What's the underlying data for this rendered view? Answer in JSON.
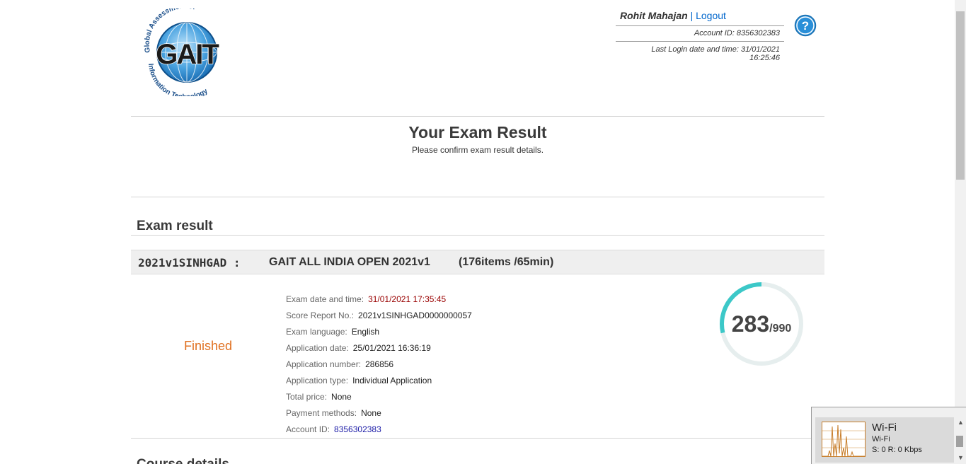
{
  "logo": {
    "arc_text": "Global Assessment of",
    "main_text": "GAIT",
    "bottom_text": "Information Technology"
  },
  "user": {
    "name": "Rohit Mahajan",
    "separator": "|",
    "logout_label": "Logout",
    "account_line": "Account ID: 8356302383",
    "last_login": "Last Login date and time: 31/01/2021 16:25:46"
  },
  "help": {
    "icon": "help-icon",
    "glyph": "?"
  },
  "page": {
    "title": "Your Exam Result",
    "subtitle": "Please confirm exam result details."
  },
  "section": {
    "title": "Exam result"
  },
  "exam": {
    "code": "2021v1SINHGAD :",
    "name": "GAIT ALL INDIA OPEN 2021v1",
    "meta": "(176items /65min)",
    "status": "Finished",
    "details": [
      {
        "label": "Exam date and time:",
        "value": "31/01/2021 17:35:45"
      },
      {
        "label": "Score Report No.:",
        "value": "2021v1SINHGAD0000000057"
      },
      {
        "label": "Exam language:",
        "value": "English"
      },
      {
        "label": "Application date:",
        "value": "25/01/2021 16:36:19"
      },
      {
        "label": "Application number:",
        "value": "286856"
      },
      {
        "label": "Application type:",
        "value": "Individual Application"
      },
      {
        "label": "Total price:",
        "value": "None"
      },
      {
        "label": "Payment methods:",
        "value": "None"
      },
      {
        "label": "Account ID:",
        "value": "8356302383"
      }
    ],
    "score": {
      "value": "283",
      "max": "/990",
      "fraction": 0.286
    }
  },
  "next_section": {
    "title": "Course details"
  },
  "wifi": {
    "title": "Wi-Fi",
    "subtitle": "Wi-Fi",
    "rate": "S: 0 R: 0 Kbps"
  },
  "colors": {
    "status": "#e07020",
    "score_ring": "#3cc8c8",
    "score_track": "#e6eeee",
    "link": "#0066cc",
    "date_value": "#990000"
  }
}
